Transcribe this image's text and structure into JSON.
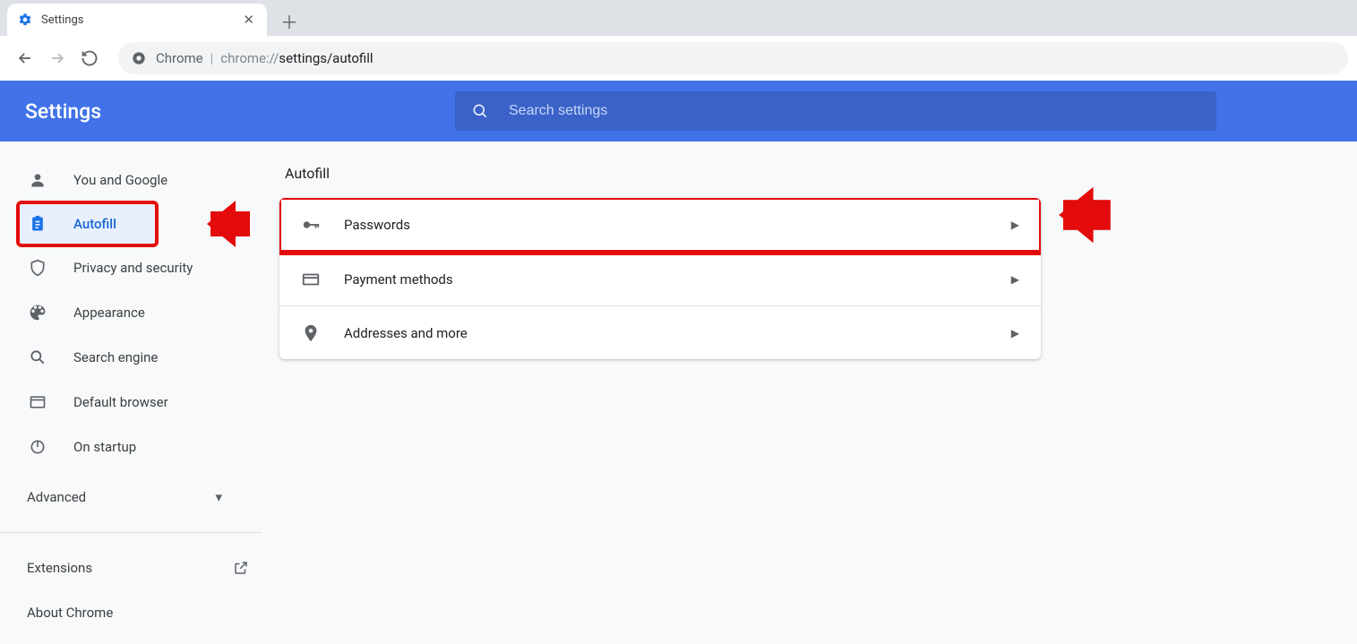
{
  "tab": {
    "title": "Settings"
  },
  "omnibox": {
    "app_label": "Chrome",
    "url_prefix": "chrome://",
    "url_path": "settings/autofill"
  },
  "header": {
    "title": "Settings"
  },
  "search": {
    "placeholder": "Search settings"
  },
  "sidebar": {
    "items": [
      {
        "label": "You and Google"
      },
      {
        "label": "Autofill"
      },
      {
        "label": "Privacy and security"
      },
      {
        "label": "Appearance"
      },
      {
        "label": "Search engine"
      },
      {
        "label": "Default browser"
      },
      {
        "label": "On startup"
      }
    ],
    "advanced_label": "Advanced",
    "extensions_label": "Extensions",
    "about_label": "About Chrome"
  },
  "main": {
    "section_title": "Autofill",
    "rows": [
      {
        "label": "Passwords"
      },
      {
        "label": "Payment methods"
      },
      {
        "label": "Addresses and more"
      }
    ]
  }
}
